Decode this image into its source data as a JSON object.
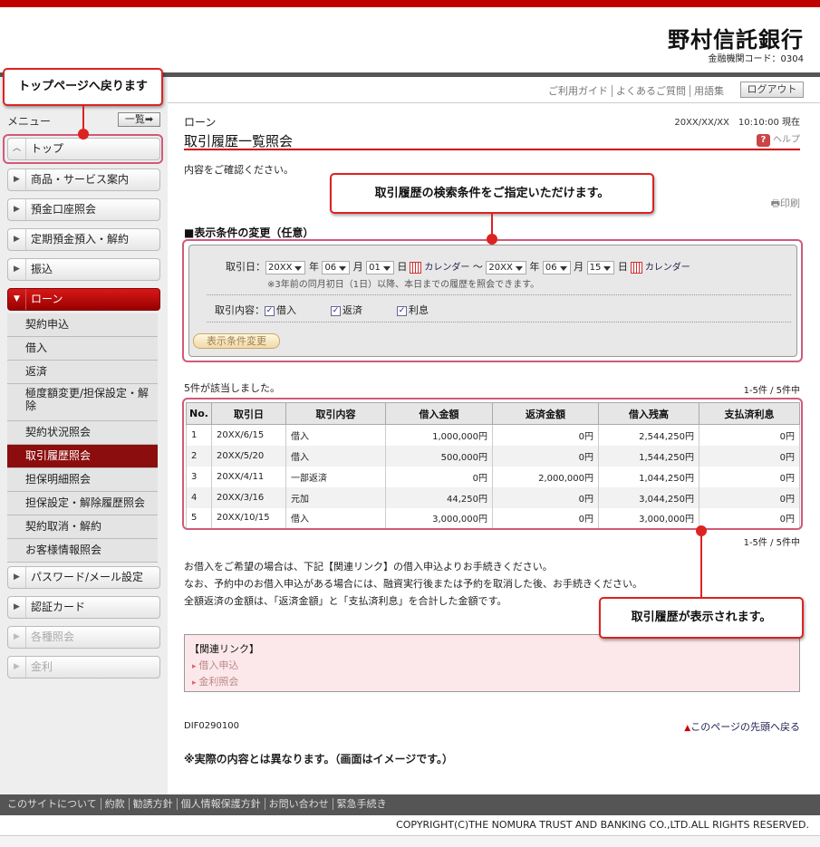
{
  "header": {
    "bank_name": "野村信託銀行",
    "bank_code": "金融機関コード：0304"
  },
  "util": {
    "links": [
      "ご利用ガイド",
      "よくあるご質問",
      "用語集"
    ],
    "logout": "ログアウト"
  },
  "sidebar": {
    "menu_label": "メニュー",
    "list_button": "一覧➡",
    "items": [
      {
        "label": "トップ",
        "arrow": "︿"
      },
      {
        "label": "商品・サービス案内",
        "arrow": "▶"
      },
      {
        "label": "預金口座照会",
        "arrow": "▶"
      },
      {
        "label": "定期預金預入・解約",
        "arrow": "▶"
      },
      {
        "label": "振込",
        "arrow": "▶"
      },
      {
        "label": "ローン",
        "arrow": "▼"
      },
      {
        "label": "パスワード/メール設定",
        "arrow": "▶"
      },
      {
        "label": "認証カード",
        "arrow": "▶"
      },
      {
        "label": "各種照会",
        "arrow": "▶"
      },
      {
        "label": "金利",
        "arrow": "▶"
      }
    ],
    "sub_items": [
      "契約申込",
      "借入",
      "返済",
      "極度額変更/担保設定・解除",
      "契約状況照会",
      "取引履歴照会",
      "担保明細照会",
      "担保設定・解除履歴照会",
      "契約取消・解約",
      "お客様情報照会"
    ]
  },
  "callouts": {
    "top": "トップページへ戻ります",
    "search": "取引履歴の検索条件をご指定いただけます。",
    "result": "取引履歴が表示されます。"
  },
  "main": {
    "breadcrumb": "ローン",
    "datetime": "20XX/XX/XX　10:10:00 現在",
    "title": "取引履歴一覧照会",
    "help": "ヘルプ",
    "intro": "内容をご確認ください。",
    "print": "印刷",
    "section": "■表示条件の変更（任意）",
    "form": {
      "date_label": "取引日：",
      "from": {
        "year": "20XX",
        "month": "06",
        "day": "01"
      },
      "to": {
        "year": "20XX",
        "month": "06",
        "day": "15"
      },
      "nen": "年",
      "tsuki": "月",
      "hi": "日",
      "tilde": "〜",
      "calendar": "カレンダー",
      "note": "※3年前の同月初日（1日）以降、本日までの履歴を照会できます。",
      "type_label": "取引内容：",
      "types": [
        "借入",
        "返済",
        "利息"
      ],
      "button": "表示条件変更"
    },
    "count": "5件が該当しました。",
    "paging": "1-5件 / 5件中",
    "table": {
      "headers": [
        "No.",
        "取引日",
        "取引内容",
        "借入金額",
        "返済金額",
        "借入残高",
        "支払済利息"
      ],
      "rows": [
        [
          "1",
          "20XX/6/15",
          "借入",
          "1,000,000円",
          "0円",
          "2,544,250円",
          "0円"
        ],
        [
          "2",
          "20XX/5/20",
          "借入",
          "500,000円",
          "0円",
          "1,544,250円",
          "0円"
        ],
        [
          "3",
          "20XX/4/11",
          "一部返済",
          "0円",
          "2,000,000円",
          "1,044,250円",
          "0円"
        ],
        [
          "4",
          "20XX/3/16",
          "元加",
          "44,250円",
          "0円",
          "3,044,250円",
          "0円"
        ],
        [
          "5",
          "20XX/10/15",
          "借入",
          "3,000,000円",
          "0円",
          "3,000,000円",
          "0円"
        ]
      ]
    },
    "notes": [
      "お借入をご希望の場合は、下記【関連リンク】の借入申込よりお手続きください。",
      "なお、予約中のお借入申込がある場合には、融資実行後または予約を取消した後、お手続きください。",
      "全額返済の金額は、「返済金額」と「支払済利息」を合計した金額です。"
    ],
    "related": {
      "title": "【関連リンク】",
      "links": [
        "借入申込",
        "金利照会"
      ]
    },
    "page_id": "DIF0290100",
    "page_top": "このページの先頭へ戻る",
    "disclaimer": "※実際の内容とは異なります。（画面はイメージです。）"
  },
  "footer": {
    "links": [
      "このサイトについて",
      "約款",
      "勧誘方針",
      "個人情報保護方針",
      "お問い合わせ",
      "緊急手続き"
    ],
    "copyright": "COPYRIGHT(C)THE NOMURA TRUST AND BANKING CO.,LTD.ALL RIGHTS RESERVED."
  },
  "colors": {
    "brand": "#c00000",
    "highlight": "#d05a7a"
  }
}
